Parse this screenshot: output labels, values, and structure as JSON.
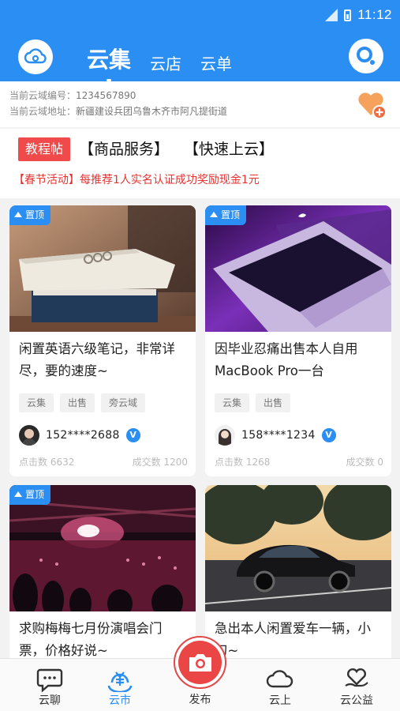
{
  "status_bar": {
    "time": "11:12"
  },
  "header": {
    "tabs": [
      {
        "label": "云集",
        "active": true
      },
      {
        "label": "云店",
        "active": false
      },
      {
        "label": "云单",
        "active": false
      }
    ],
    "accent_color": "#2b8ef2"
  },
  "info": {
    "id_label": "当前云域编号：",
    "id_value": "1234567890",
    "addr_label": "当前云域地址：",
    "addr_value": "新疆建设兵团乌鲁木齐市阿凡提街道"
  },
  "tags": {
    "tutorial": "教程帖",
    "link1": "【商品服务】",
    "link2": "【快速上云】",
    "promo": "【春节活动】每推荐1人实名认证成功奖励现金1元"
  },
  "cards": [
    {
      "pinned": true,
      "pin_label": "置顶",
      "title": "闲置英语六级笔记，非常详尽，要的速度~",
      "chips": [
        "云集",
        "出售",
        "旁云域"
      ],
      "user": "152****2688",
      "clicks": "点击数 6632",
      "deals": "成交数 1200"
    },
    {
      "pinned": true,
      "pin_label": "置顶",
      "title": "因毕业忍痛出售本人自用MacBook Pro一台",
      "chips": [
        "云集",
        "出售"
      ],
      "user": "158****1234",
      "clicks": "点击数 1268",
      "deals": "成交数 0"
    },
    {
      "pinned": true,
      "pin_label": "置顶",
      "title": "求购梅梅七月份演唱会门票，价格好说~"
    },
    {
      "pinned": false,
      "title": "急出本人闲置爱车一辆，小刀~"
    }
  ],
  "bottom_nav": [
    {
      "label": "云聊",
      "icon": "chat-icon",
      "active": false
    },
    {
      "label": "云市",
      "icon": "yen-market-icon",
      "active": true
    },
    {
      "label": "发布",
      "icon": "camera-icon",
      "active": false
    },
    {
      "label": "云上",
      "icon": "cloud-icon",
      "active": false
    },
    {
      "label": "云公益",
      "icon": "heart-hand-icon",
      "active": false
    }
  ],
  "verified_badge": "V"
}
